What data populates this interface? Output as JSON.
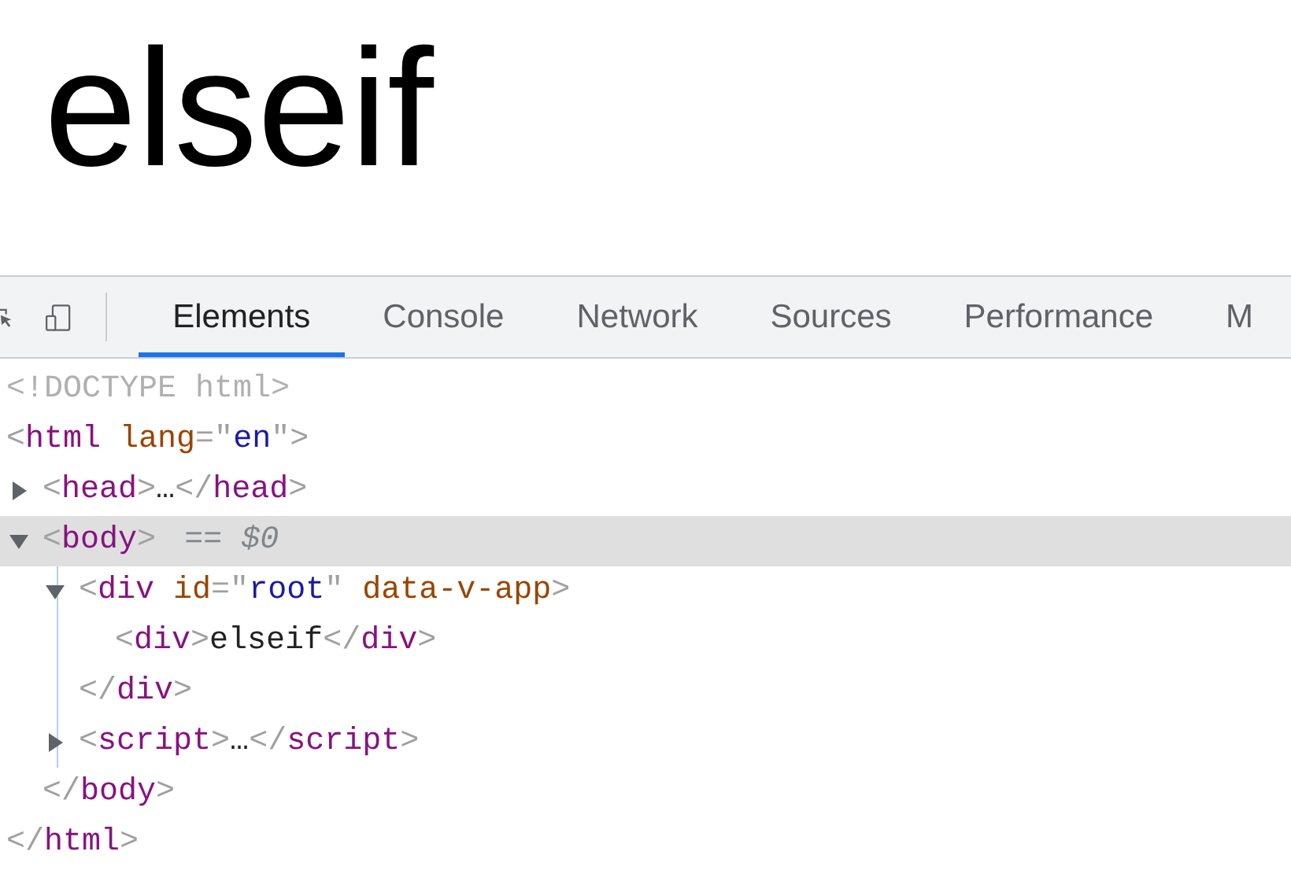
{
  "page": {
    "heading": "elseif"
  },
  "devtools": {
    "tabs": [
      {
        "label": "Elements",
        "selected": true
      },
      {
        "label": "Console",
        "selected": false
      },
      {
        "label": "Network",
        "selected": false
      },
      {
        "label": "Sources",
        "selected": false
      },
      {
        "label": "Performance",
        "selected": false
      },
      {
        "label": "M",
        "selected": false
      }
    ],
    "dom_tree": [
      {
        "line": [
          {
            "kind": "doctype",
            "text": "<!DOCTYPE html>"
          }
        ]
      },
      {
        "line": [
          {
            "kind": "punct",
            "text": "<"
          },
          {
            "kind": "tag",
            "text": "html"
          },
          {
            "kind": "attr",
            "text": " lang"
          },
          {
            "kind": "punct",
            "text": "=\""
          },
          {
            "kind": "value",
            "text": "en"
          },
          {
            "kind": "punct",
            "text": "\">"
          }
        ],
        "close": [
          {
            "kind": "punct",
            "text": "</"
          },
          {
            "kind": "tag",
            "text": "html"
          },
          {
            "kind": "punct",
            "text": ">"
          }
        ],
        "children": [
          {
            "expanded": false,
            "selected": false,
            "line": [
              {
                "kind": "punct",
                "text": "<"
              },
              {
                "kind": "tag",
                "text": "head"
              },
              {
                "kind": "punct",
                "text": ">"
              },
              {
                "kind": "plain",
                "text": "…"
              },
              {
                "kind": "punct",
                "text": "</"
              },
              {
                "kind": "tag",
                "text": "head"
              },
              {
                "kind": "punct",
                "text": ">"
              }
            ]
          },
          {
            "expanded": true,
            "selected": true,
            "marker": "== $0",
            "line": [
              {
                "kind": "punct",
                "text": "<"
              },
              {
                "kind": "tag",
                "text": "body"
              },
              {
                "kind": "punct",
                "text": ">"
              }
            ],
            "close": [
              {
                "kind": "punct",
                "text": "</"
              },
              {
                "kind": "tag",
                "text": "body"
              },
              {
                "kind": "punct",
                "text": ">"
              }
            ],
            "children": [
              {
                "expanded": true,
                "selected": false,
                "line": [
                  {
                    "kind": "punct",
                    "text": "<"
                  },
                  {
                    "kind": "tag",
                    "text": "div"
                  },
                  {
                    "kind": "attr",
                    "text": " id"
                  },
                  {
                    "kind": "punct",
                    "text": "=\""
                  },
                  {
                    "kind": "value",
                    "text": "root"
                  },
                  {
                    "kind": "punct",
                    "text": "\""
                  },
                  {
                    "kind": "attr",
                    "text": " data-v-app"
                  },
                  {
                    "kind": "punct",
                    "text": ">"
                  }
                ],
                "close": [
                  {
                    "kind": "punct",
                    "text": "</"
                  },
                  {
                    "kind": "tag",
                    "text": "div"
                  },
                  {
                    "kind": "punct",
                    "text": ">"
                  }
                ],
                "children": [
                  {
                    "line": [
                      {
                        "kind": "punct",
                        "text": "<"
                      },
                      {
                        "kind": "tag",
                        "text": "div"
                      },
                      {
                        "kind": "punct",
                        "text": ">"
                      },
                      {
                        "kind": "plain",
                        "text": "elseif"
                      },
                      {
                        "kind": "punct",
                        "text": "</"
                      },
                      {
                        "kind": "tag",
                        "text": "div"
                      },
                      {
                        "kind": "punct",
                        "text": ">"
                      }
                    ]
                  }
                ]
              },
              {
                "expanded": false,
                "selected": false,
                "line": [
                  {
                    "kind": "punct",
                    "text": "<"
                  },
                  {
                    "kind": "tag",
                    "text": "script"
                  },
                  {
                    "kind": "punct",
                    "text": ">"
                  },
                  {
                    "kind": "plain",
                    "text": "…"
                  },
                  {
                    "kind": "punct",
                    "text": "</"
                  },
                  {
                    "kind": "tag",
                    "text": "script"
                  },
                  {
                    "kind": "punct",
                    "text": ">"
                  }
                ]
              }
            ]
          }
        ]
      }
    ]
  }
}
